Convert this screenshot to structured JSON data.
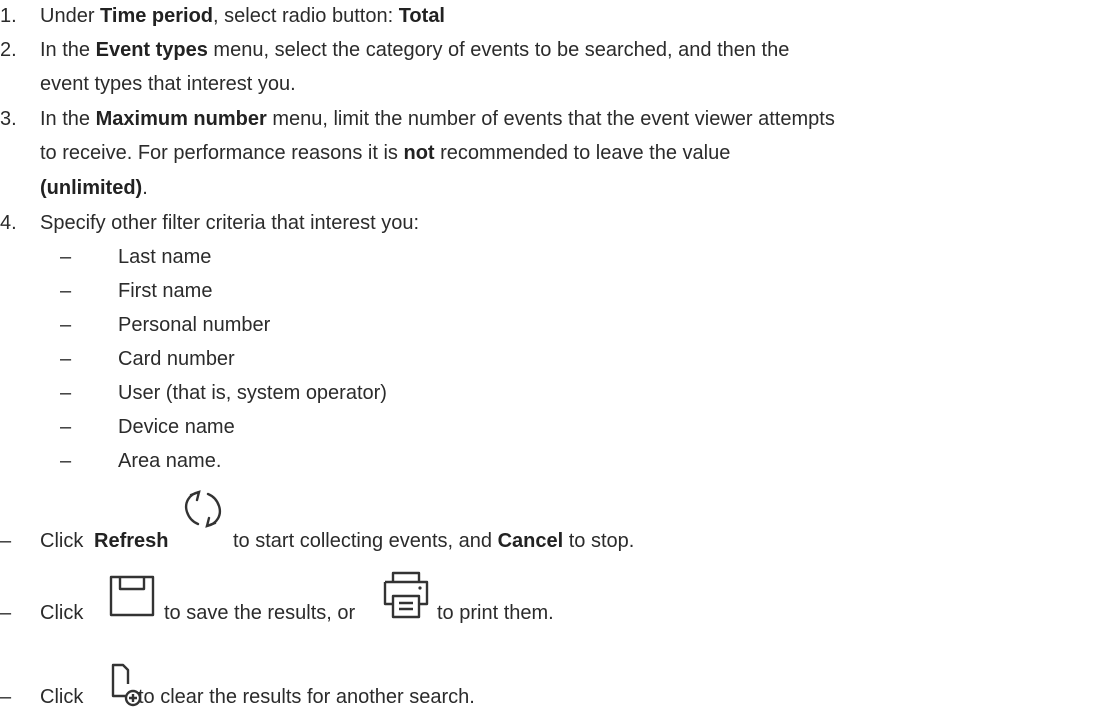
{
  "steps": [
    {
      "number": "1.",
      "lines": [
        {
          "pre": "Under ",
          "bold1": "Time period",
          "mid": ", select radio button: ",
          "bold2": "Total",
          "post": ""
        }
      ]
    },
    {
      "number": "2.",
      "line1": {
        "pre": "In the ",
        "bold": "Event types",
        "post": " menu, select the category of events to be searched, and then the"
      },
      "line2": "event types that interest you."
    },
    {
      "number": "3.",
      "line1": {
        "pre": "In the ",
        "bold": "Maximum number",
        "post": " menu, limit the number of events that the event viewer attempts"
      },
      "line2": {
        "pre": "to receive. For performance reasons it is ",
        "bold": "not",
        "post": " recommended to leave the value"
      },
      "line3": {
        "bold": "(unlimited)",
        "post": "."
      }
    },
    {
      "number": "4.",
      "text": "Specify other filter criteria that interest you:",
      "criteria": [
        "Last name",
        "First name",
        "Personal number",
        "Card number",
        "User (that is, system operator)",
        "Device name",
        "Area name."
      ]
    }
  ],
  "bullets": {
    "dash": "–",
    "refresh": {
      "pre": "Click ",
      "bold1": "Refresh",
      "mid": " to start collecting events, and ",
      "bold2": "Cancel",
      "post": " to stop.",
      "icon": "refresh-icon"
    },
    "save": {
      "pre": "Click ",
      "mid": " to save the results, or ",
      "post": " to print them.",
      "icon1": "save-icon",
      "icon2": "print-icon"
    },
    "clear": {
      "pre": "Click ",
      "post": " to clear the results for another search.",
      "icon": "new-document-icon"
    }
  },
  "colors": {
    "text": "#2b2b2b",
    "icon": "#333333"
  }
}
